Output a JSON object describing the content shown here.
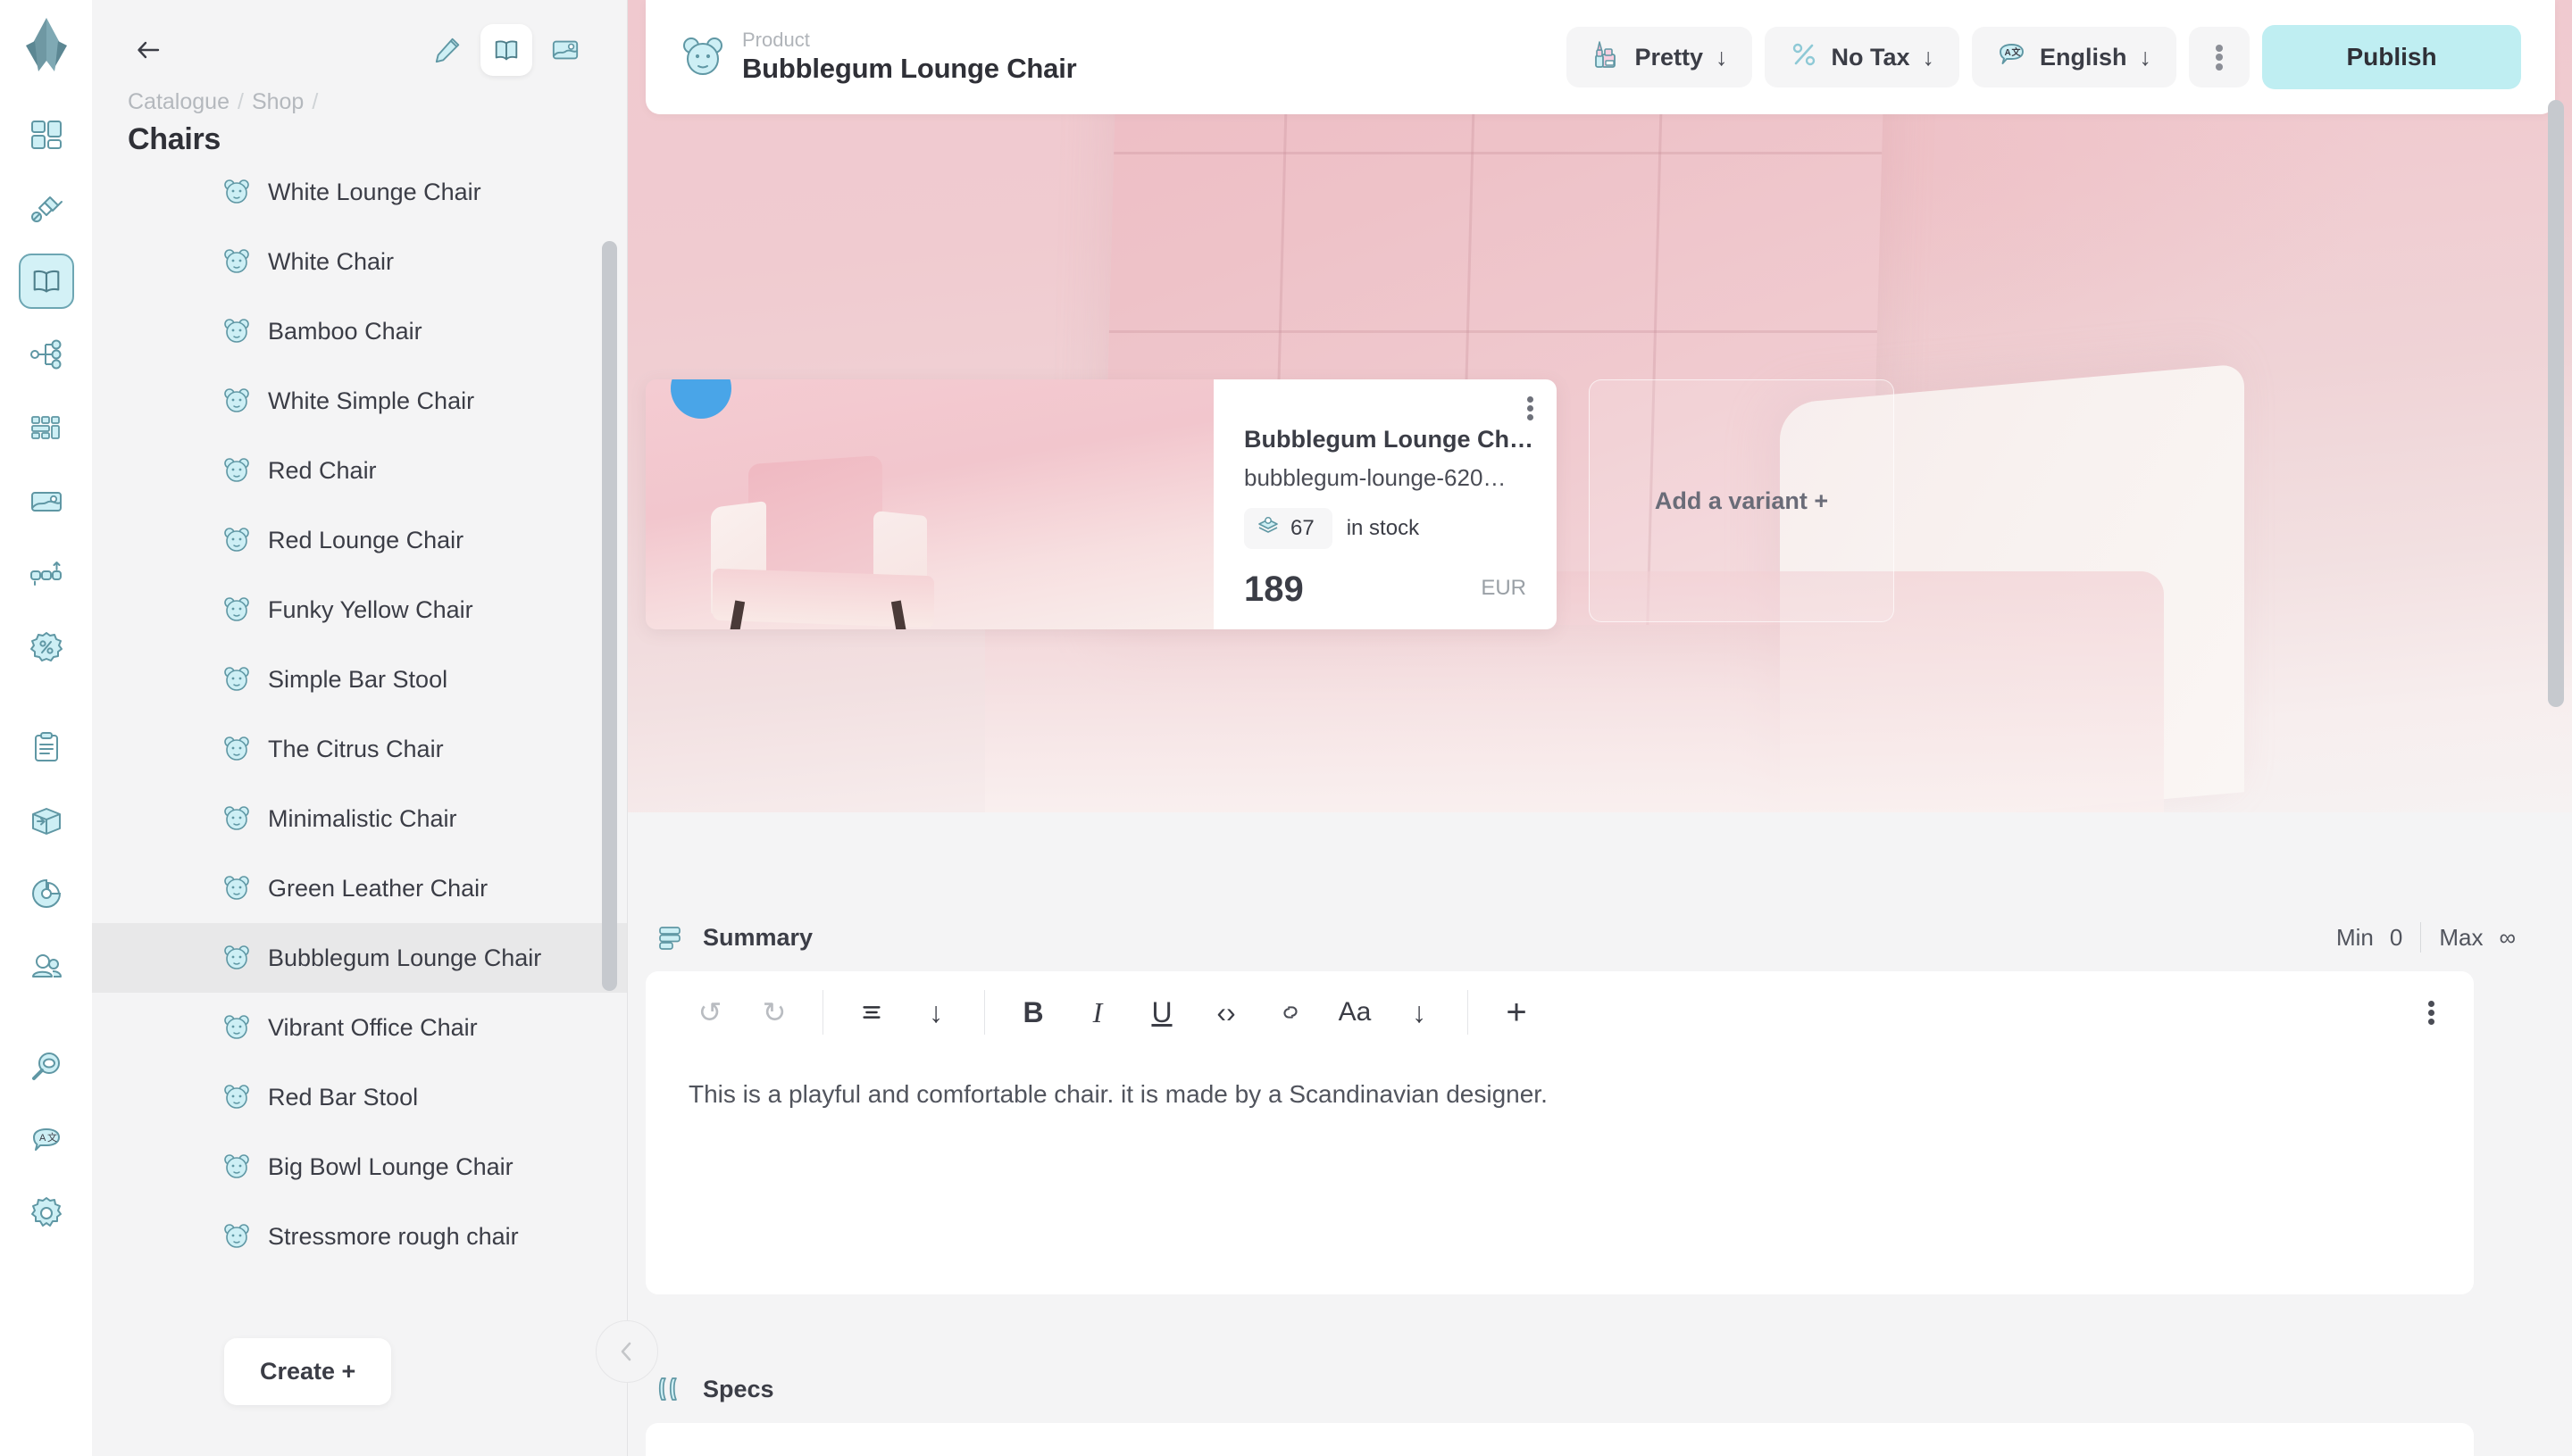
{
  "rail": {
    "logo": "crystal-logo",
    "items": [
      {
        "name": "dashboard-icon",
        "label": "Dashboard",
        "active": false
      },
      {
        "name": "plugins-icon",
        "label": "Plugins",
        "active": false
      },
      {
        "name": "catalogue-book-icon",
        "label": "Catalogue",
        "active": true
      },
      {
        "name": "hierarchy-icon",
        "label": "Structure",
        "active": false
      },
      {
        "name": "grid-layout-icon",
        "label": "Layout",
        "active": false
      },
      {
        "name": "image-icon",
        "label": "Media",
        "active": false
      },
      {
        "name": "export-nodes-icon",
        "label": "Export",
        "active": false
      },
      {
        "name": "discount-percent-icon",
        "label": "Discounts",
        "active": false
      },
      {
        "name": "clipboard-icon",
        "label": "Orders",
        "active": false
      },
      {
        "name": "box-shipping-icon",
        "label": "Shipping",
        "active": false
      },
      {
        "name": "pie-chart-icon",
        "label": "Analytics",
        "active": false
      },
      {
        "name": "users-icon",
        "label": "Customers",
        "active": false
      },
      {
        "name": "search-magnifier-icon",
        "label": "Search",
        "active": false
      },
      {
        "name": "translate-icon",
        "label": "Languages",
        "active": false
      },
      {
        "name": "gear-icon",
        "label": "Settings",
        "active": false
      }
    ]
  },
  "sidebar": {
    "back_label": "Back",
    "tools": [
      {
        "name": "pencil-edit-icon",
        "label": "Edit",
        "selected": false
      },
      {
        "name": "catalogue-book-icon",
        "label": "Catalogue",
        "selected": true
      },
      {
        "name": "image-icon",
        "label": "Media",
        "selected": false
      }
    ],
    "breadcrumb": [
      "Catalogue",
      "Shop"
    ],
    "breadcrumb_separator": "/",
    "title": "Chairs",
    "items": [
      {
        "label": "White Lounge Chair",
        "selected": false
      },
      {
        "label": "White Chair",
        "selected": false
      },
      {
        "label": "Bamboo Chair",
        "selected": false
      },
      {
        "label": "White Simple Chair",
        "selected": false
      },
      {
        "label": "Red Chair",
        "selected": false
      },
      {
        "label": "Red Lounge Chair",
        "selected": false
      },
      {
        "label": "Funky Yellow Chair",
        "selected": false
      },
      {
        "label": "Simple Bar Stool",
        "selected": false
      },
      {
        "label": "The Citrus Chair",
        "selected": false
      },
      {
        "label": "Minimalistic Chair",
        "selected": false
      },
      {
        "label": "Green Leather Chair",
        "selected": false
      },
      {
        "label": "Bubblegum Lounge Chair",
        "selected": true
      },
      {
        "label": "Vibrant Office Chair",
        "selected": false
      },
      {
        "label": "Red Bar Stool",
        "selected": false
      },
      {
        "label": "Big Bowl Lounge Chair",
        "selected": false
      },
      {
        "label": "Stressmore rough chair",
        "selected": false
      }
    ],
    "create_label": "Create +",
    "collapse_label": "Collapse panel"
  },
  "header": {
    "kicker": "Product",
    "title": "Bubblegum Lounge Chair",
    "topic_button": {
      "label": "Pretty",
      "icon": "lipstick-icon",
      "caret": "↓"
    },
    "tax_button": {
      "label": "No Tax",
      "icon": "percent-icon",
      "caret": "↓"
    },
    "language_button": {
      "label": "English",
      "icon": "translate-icon",
      "caret": "↓"
    },
    "more_label": "More options",
    "publish_label": "Publish"
  },
  "variants": {
    "card": {
      "name": "Bubblegum Lounge Ch…",
      "slug": "bubblegum-lounge-620…",
      "stock_count": "67",
      "stock_label": "in stock",
      "stock_icon": "stock-box-icon",
      "price": "189",
      "currency": "EUR",
      "more_label": "Variant options"
    },
    "add_label": "Add a variant +"
  },
  "summary": {
    "icon": "summary-lines-icon",
    "label": "Summary",
    "min_key": "Min",
    "min_value": "0",
    "max_key": "Max",
    "max_value": "∞",
    "toolbar": [
      {
        "name": "undo-icon",
        "glyph": "↺",
        "dim": true
      },
      {
        "name": "redo-icon",
        "glyph": "↻",
        "dim": true
      },
      {
        "name": "align-icon",
        "glyph": "☰",
        "dim": false
      },
      {
        "name": "align-dropdown-icon",
        "glyph": "↓",
        "dim": false
      },
      {
        "name": "bold-icon",
        "glyph": "B",
        "dim": false
      },
      {
        "name": "italic-icon",
        "glyph": "I",
        "dim": false
      },
      {
        "name": "underline-icon",
        "glyph": "U",
        "dim": false
      },
      {
        "name": "code-icon",
        "glyph": "‹›",
        "dim": false
      },
      {
        "name": "link-icon",
        "glyph": "⚭",
        "dim": false
      },
      {
        "name": "text-style-icon",
        "glyph": "Aa",
        "dim": false
      },
      {
        "name": "text-style-dropdown-icon",
        "glyph": "↓",
        "dim": false
      },
      {
        "name": "add-block-icon",
        "glyph": "+",
        "dim": false
      }
    ],
    "more_label": "Editor options",
    "body_text": "This is a playful and comfortable chair. it is made by a Scandinavian designer."
  },
  "specs": {
    "icon": "specs-icon",
    "label": "Specs"
  },
  "colors": {
    "accent": "#bfeef2",
    "icon_fill": "#cdeff5",
    "icon_stroke": "#5f97a4",
    "text": "#3b3d46",
    "muted": "#b0b4b9",
    "sidebar_bg": "#f4f4f5",
    "selected_row": "#e8e8e9"
  }
}
